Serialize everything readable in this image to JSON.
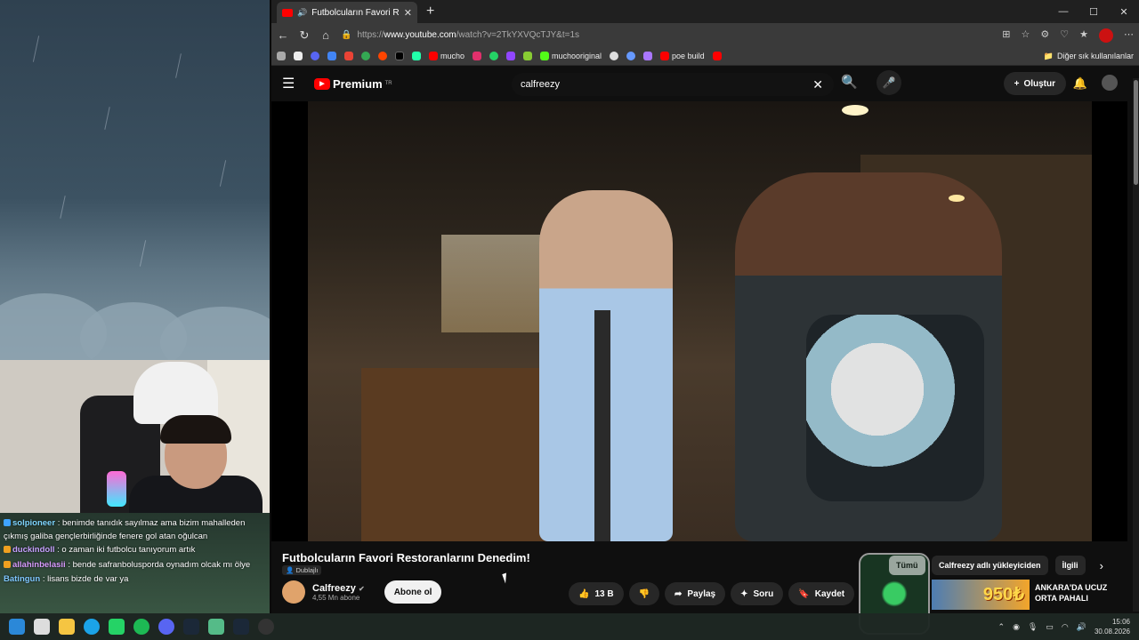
{
  "browser": {
    "tab_title": "Futbolcuların Favori Restoranl",
    "url_prefix": "https://",
    "url_domain": "www.youtube.com",
    "url_path": "/watch?v=2TkYXVQcTJY&t=1s",
    "bookmarks": [
      "mucho",
      "muchooriginal",
      "poe build"
    ],
    "other_bookmarks": "Diğer sık kullanılanlar"
  },
  "youtube": {
    "logo": "Premium",
    "region": "TR",
    "search_value": "calfreezy",
    "create_label": "Oluştur"
  },
  "video": {
    "title": "Futbolcuların Favori Restoranlarını Denedim!",
    "dubbed_label": "Dublajlı",
    "channel": "Calfreezy",
    "subscribers": "4,55 Mn abone",
    "subscribe_label": "Abone ol",
    "likes": "13 B",
    "share_label": "Paylaş",
    "ask_label": "Soru",
    "save_label": "Kaydet"
  },
  "chips": {
    "all": "Tümü",
    "from_uploader": "Calfreezy adlı yükleyiciden",
    "related": "İlgili"
  },
  "recommendation": {
    "thumb_text": "950₺",
    "title": "ANKARA'DA UCUZ ORTA PAHALI"
  },
  "chat": [
    {
      "user": "solpioneer",
      "text": ": benimde tanıdık sayılmaz ama bizim mahalleden çıkmış galiba gençlerbirliğinde fenere gol atan oğulcan",
      "color": "#7fd6ff"
    },
    {
      "user": "duckindoll",
      "text": ": o zaman iki futbolcu tanıyorum artık",
      "color": "#c7a2ff"
    },
    {
      "user": "allahinbelasii",
      "text": ": bende safranbolusporda oynadım olcak mı ölye",
      "color": "#d99cff"
    },
    {
      "user": "Batingun",
      "text": ": lisans bizde de var ya",
      "color": "#7fc8ff"
    }
  ],
  "clock": {
    "time": "15:06",
    "date": "30.08.2026"
  },
  "colors": {
    "accent": "#ff0000",
    "bg": "#0f0f0f"
  }
}
